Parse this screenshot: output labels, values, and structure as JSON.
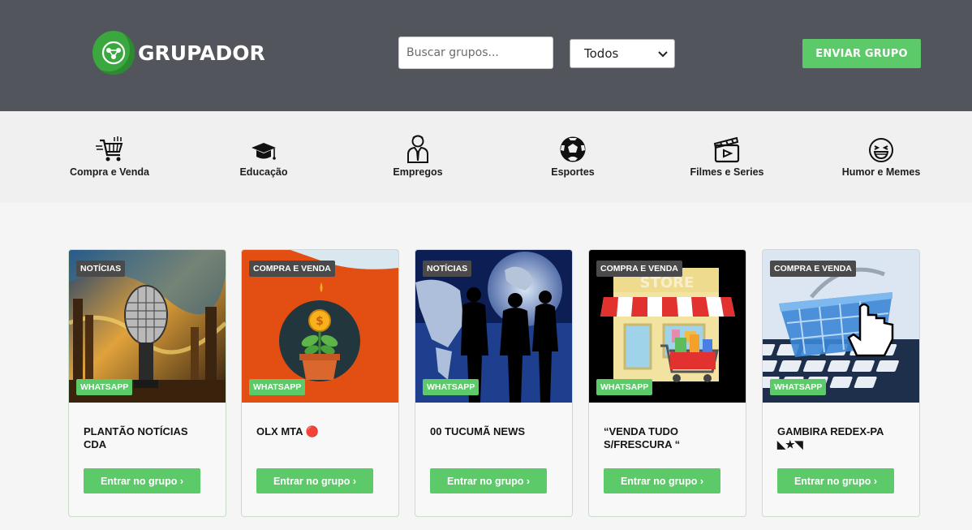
{
  "header": {
    "logo_text": "GRUPADOR",
    "search_placeholder": "Buscar grupos...",
    "filter_selected": "Todos",
    "send_button": "ENVIAR GRUPO"
  },
  "categories": [
    {
      "label": "Compra e Venda",
      "icon": "shopping-cart-icon"
    },
    {
      "label": "Educação",
      "icon": "graduation-cap-icon"
    },
    {
      "label": "Empregos",
      "icon": "employee-icon"
    },
    {
      "label": "Esportes",
      "icon": "soccer-ball-icon"
    },
    {
      "label": "Filmes e Series",
      "icon": "clapperboard-icon"
    },
    {
      "label": "Humor e Memes",
      "icon": "laughing-face-icon"
    }
  ],
  "cards": [
    {
      "tag": "NOTÍCIAS",
      "platform": "WHATSAPP",
      "title": "PLANTÃO NOTÍCIAS CDA",
      "button": "Entrar no grupo ›"
    },
    {
      "tag": "COMPRA E VENDA",
      "platform": "WHATSAPP",
      "title": "OLX MTA 🔴",
      "button": "Entrar no grupo ›"
    },
    {
      "tag": "NOTÍCIAS",
      "platform": "WHATSAPP",
      "title": "00 TUCUMÃ NEWS",
      "button": "Entrar no grupo ›"
    },
    {
      "tag": "COMPRA E VENDA",
      "platform": "WHATSAPP",
      "title": "“VENDA TUDO S/FRESCURA “",
      "button": "Entrar no grupo ›"
    },
    {
      "tag": "COMPRA E VENDA",
      "platform": "WHATSAPP",
      "title": "GAMBIRA REDEX-PA ◣★◥",
      "button": "Entrar no grupo ›"
    }
  ],
  "card_thumbnails": [
    "microphone-image",
    "money-plant-image",
    "globe-people-image",
    "store-image",
    "shopping-basket-keyboard-image"
  ]
}
